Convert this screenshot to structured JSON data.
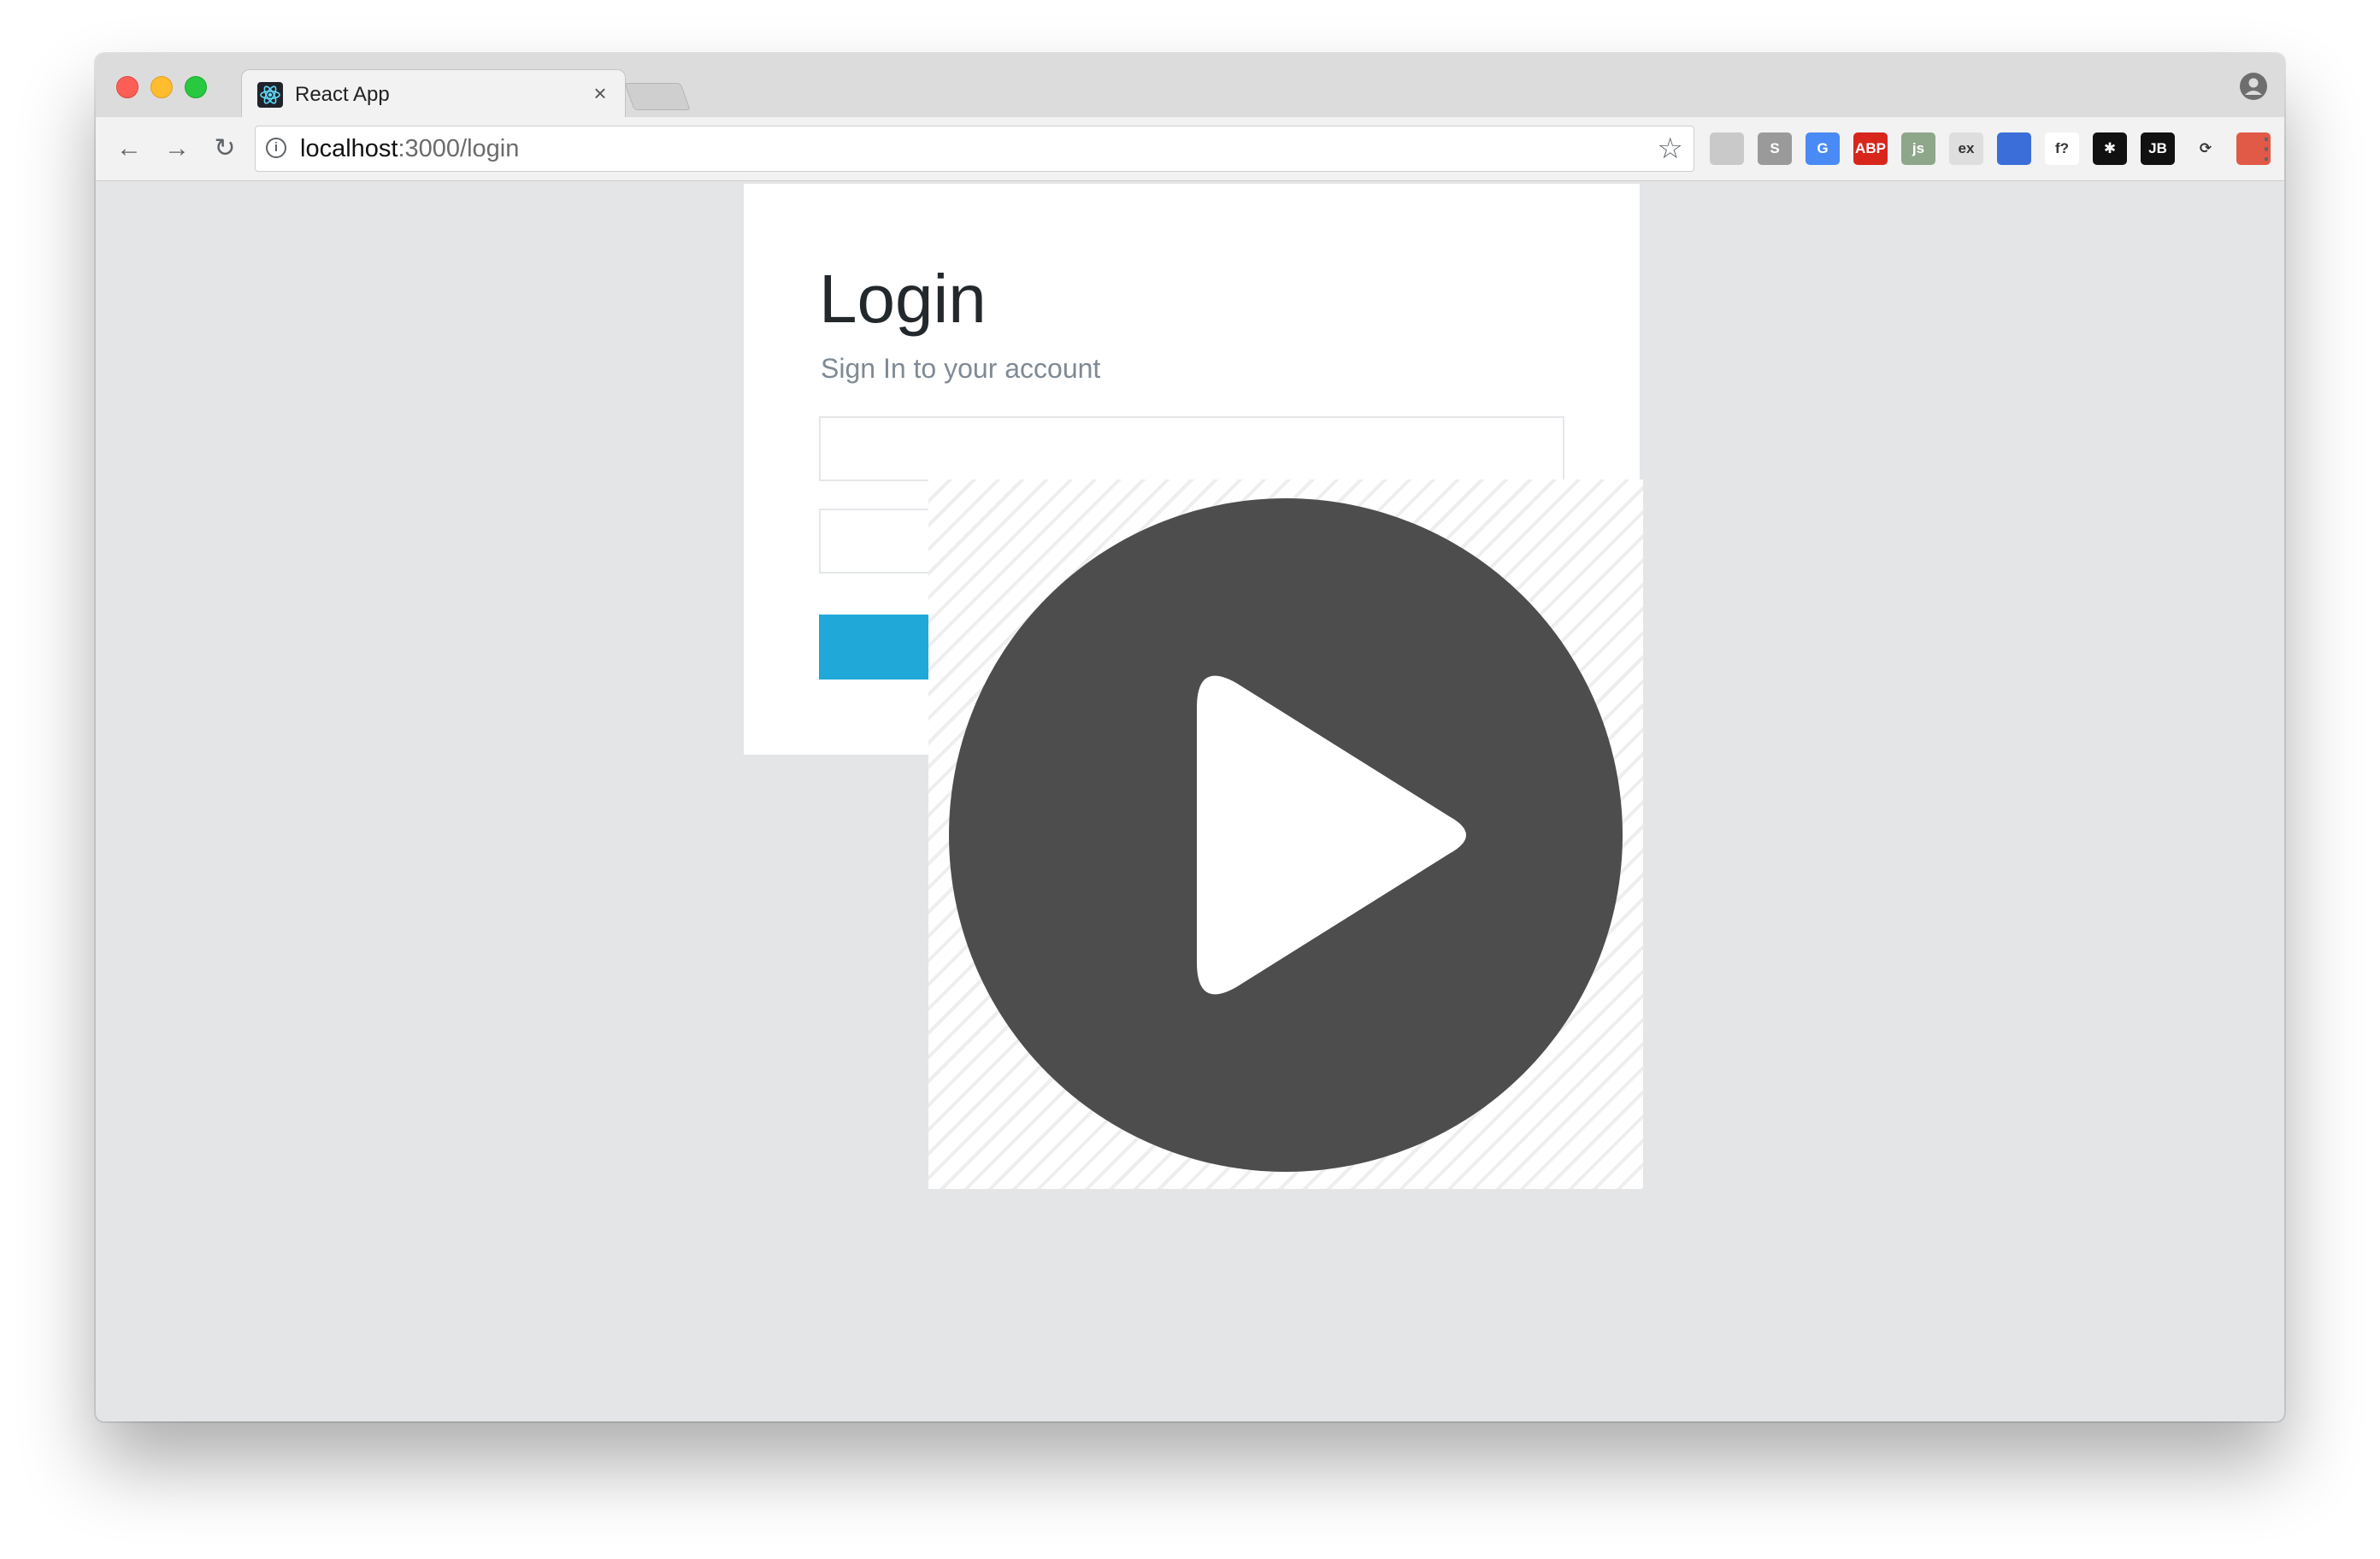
{
  "browser": {
    "tab": {
      "title": "React App",
      "close_glyph": "×",
      "favicon": "react-logo-icon"
    },
    "nav": {
      "back_glyph": "←",
      "forward_glyph": "→",
      "reload_glyph": "↻"
    },
    "address": {
      "host": "localhost",
      "path": ":3000/login",
      "info_glyph": "i",
      "star_glyph": "☆"
    },
    "extensions": [
      {
        "name": "google-drive-icon",
        "label": "",
        "color": "#c9c9c9"
      },
      {
        "name": "s-extension-icon",
        "label": "S",
        "color": "#9a9a9a"
      },
      {
        "name": "google-translate-icon",
        "label": "G",
        "color": "#4a8af4"
      },
      {
        "name": "adblock-plus-icon",
        "label": "ABP",
        "color": "#d8261d"
      },
      {
        "name": "js-extension-icon",
        "label": "js",
        "color": "#8ea68a"
      },
      {
        "name": "ex-extension-icon",
        "label": "ex",
        "color": "#dedede"
      },
      {
        "name": "bookmark-blue-icon",
        "label": "",
        "color": "#3b6ed8"
      },
      {
        "name": "font-finder-icon",
        "label": "f?",
        "color": "#ffffff"
      },
      {
        "name": "colorful-star-icon",
        "label": "✱",
        "color": "#111111"
      },
      {
        "name": "jetbrains-icon",
        "label": "JB",
        "color": "#111111"
      },
      {
        "name": "sync-icon",
        "label": "⟳",
        "color": "#f2f2f2"
      },
      {
        "name": "red-extension-icon",
        "label": "",
        "color": "#e15a47"
      },
      {
        "name": "gray-circle-icon",
        "label": "",
        "color": "#e6e6e6"
      }
    ],
    "menu_glyph": "⋮"
  },
  "login": {
    "title": "Login",
    "subtitle": "Sign In to your account"
  },
  "colors": {
    "window_background": "#e4e5e7",
    "primary_button": "#20a8d8",
    "play_circle": "#4d4d4d"
  }
}
